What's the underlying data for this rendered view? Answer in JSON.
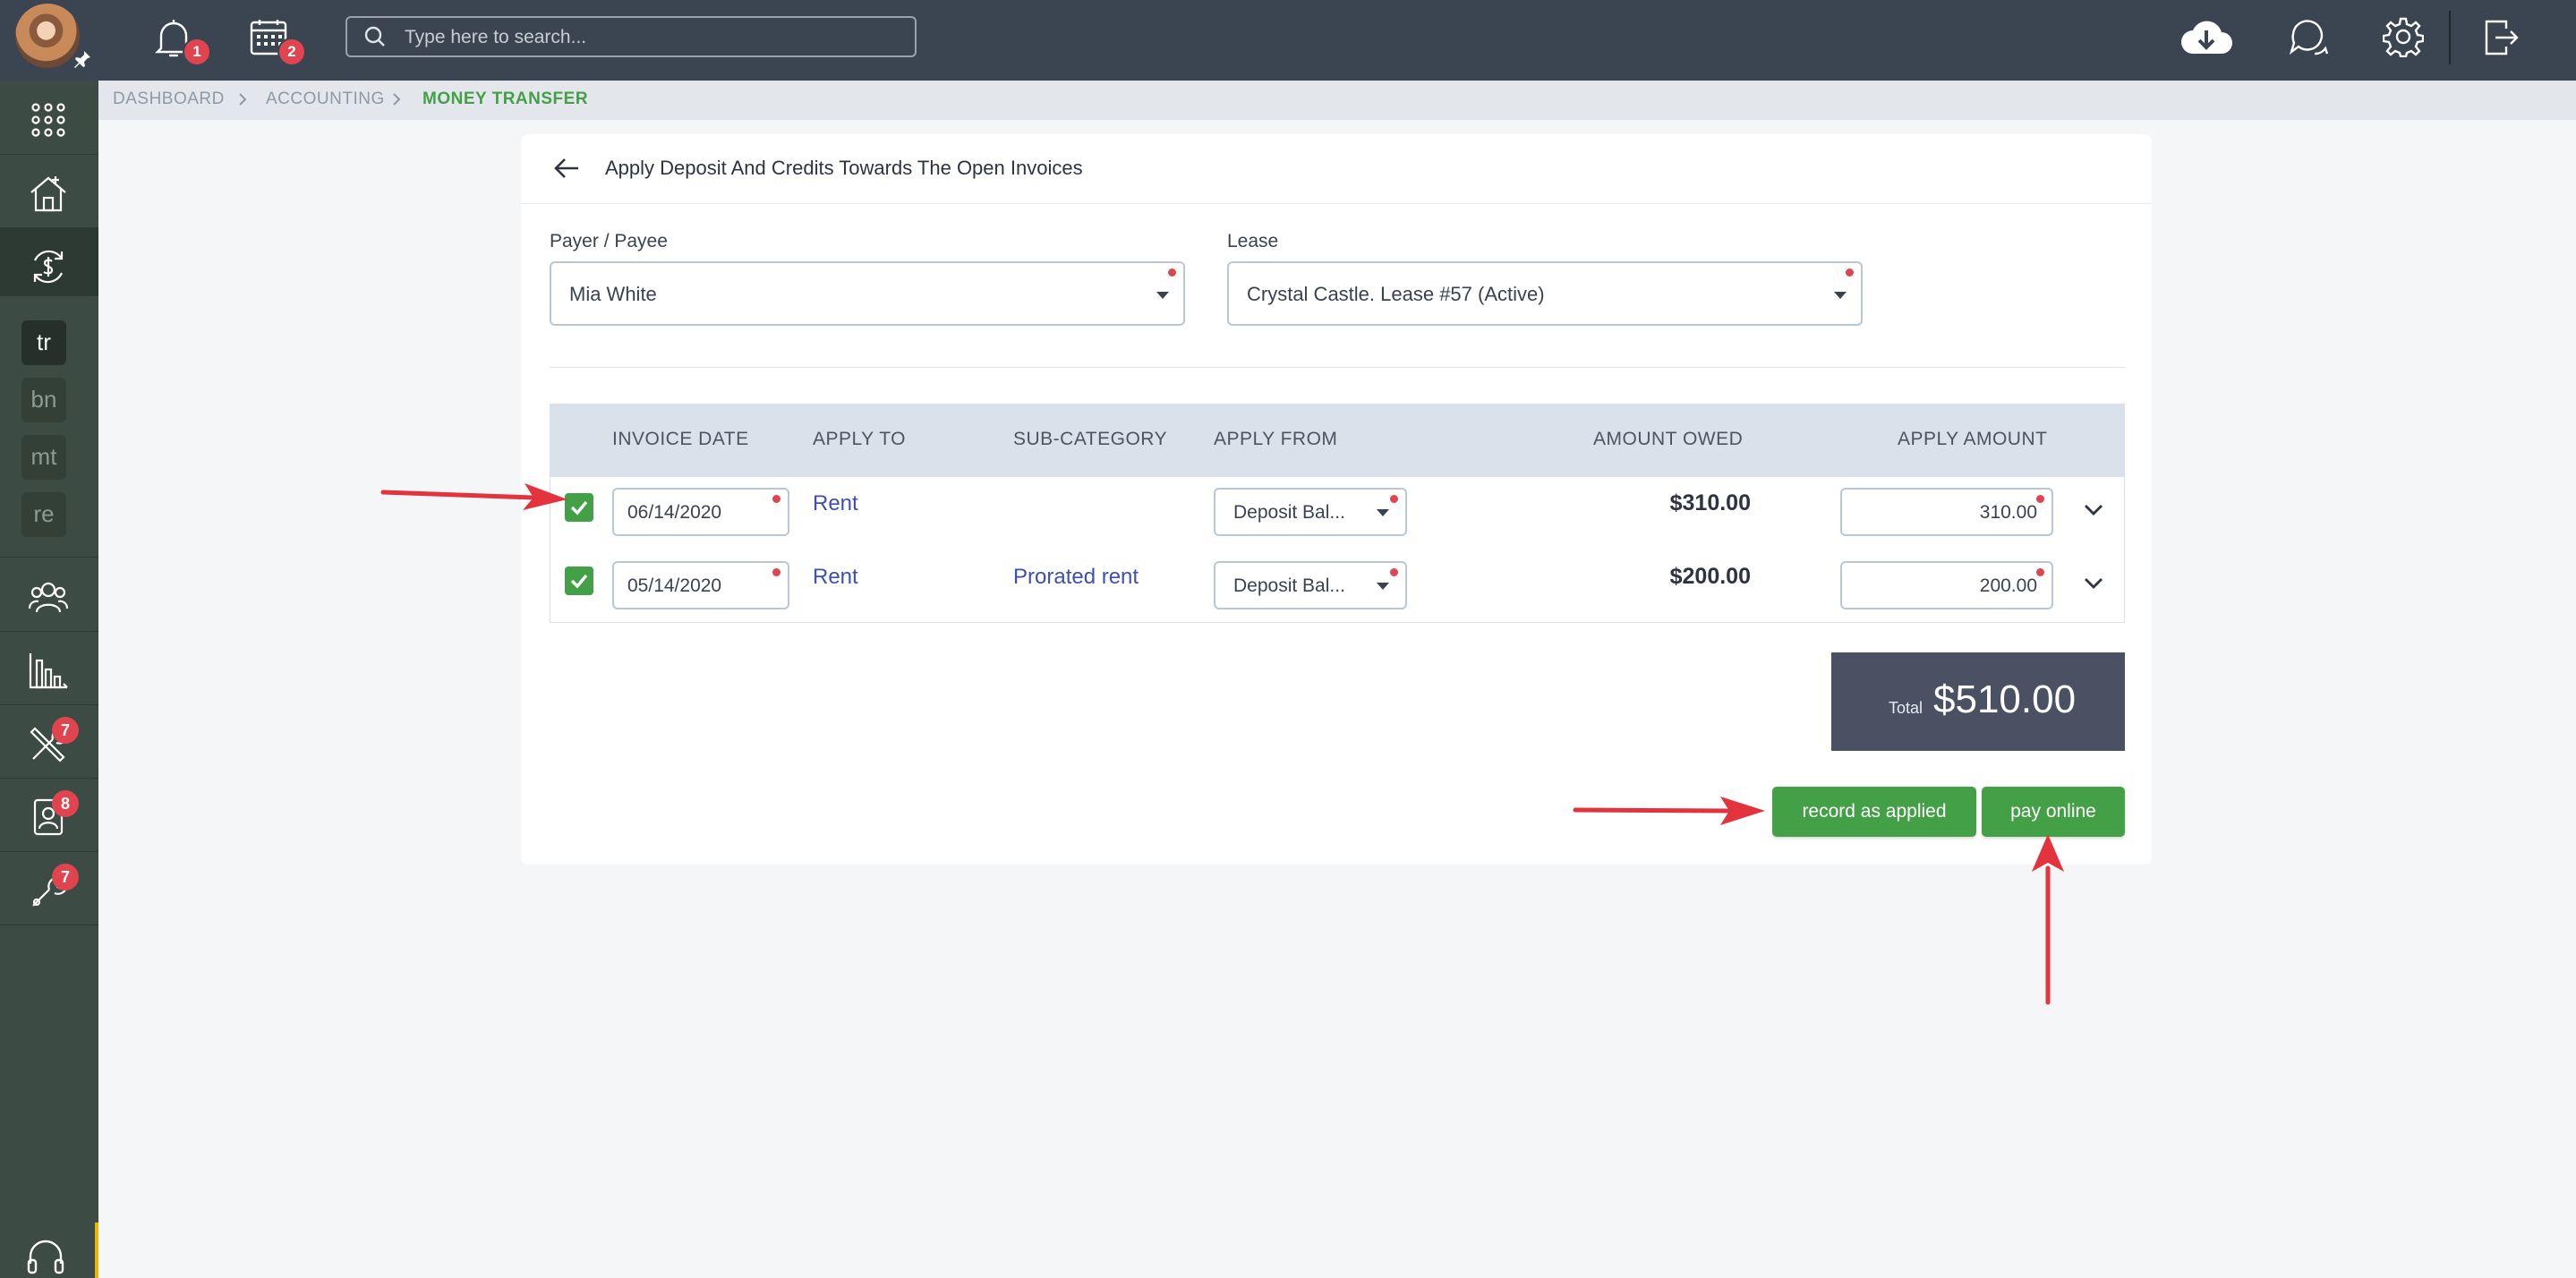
{
  "topbar": {
    "search_placeholder": "Type here to search...",
    "notifications_count": "1",
    "calendar_count": "2",
    "icons": [
      "bell-icon",
      "calendar-icon",
      "search-icon",
      "cloud-download-icon",
      "chat-icon",
      "gear-icon",
      "logout-icon"
    ]
  },
  "sidebar": {
    "items": [
      {
        "name": "apps",
        "icon": "grid-icon"
      },
      {
        "name": "properties",
        "icon": "house-icon"
      },
      {
        "name": "accounting",
        "icon": "money-transfer-icon"
      },
      {
        "name": "people",
        "icon": "people-icon"
      },
      {
        "name": "reports",
        "icon": "chart-icon"
      },
      {
        "name": "maintenance",
        "icon": "tools-icon",
        "badge": "7"
      },
      {
        "name": "applications",
        "icon": "contact-card-icon",
        "badge": "8"
      },
      {
        "name": "marketplace",
        "icon": "wrench-icon",
        "badge": "7"
      }
    ],
    "sub_items": [
      "tr",
      "bn",
      "mt",
      "re"
    ]
  },
  "breadcrumb": [
    "DASHBOARD",
    "ACCOUNTING",
    "MONEY TRANSFER"
  ],
  "card": {
    "title": "Apply Deposit And Credits Towards The Open Invoices",
    "payer_label": "Payer / Payee",
    "payer_value": "Mia White",
    "lease_label": "Lease",
    "lease_value": "Crystal Castle. Lease #57 (Active)"
  },
  "table": {
    "columns": [
      "INVOICE DATE",
      "APPLY TO",
      "SUB-CATEGORY",
      "APPLY FROM",
      "AMOUNT OWED",
      "APPLY AMOUNT"
    ],
    "rows": [
      {
        "checked": true,
        "date": "06/14/2020",
        "apply_to": "Rent",
        "sub_category": "",
        "apply_from": "Deposit Bal...",
        "owed": "$310.00",
        "apply_amount": "310.00"
      },
      {
        "checked": true,
        "date": "05/14/2020",
        "apply_to": "Rent",
        "sub_category": "Prorated rent",
        "apply_from": "Deposit Bal...",
        "owed": "$200.00",
        "apply_amount": "200.00"
      }
    ]
  },
  "total": {
    "label": "Total",
    "value": "$510.00"
  },
  "buttons": {
    "record": "record as applied",
    "pay": "pay online"
  },
  "colors": {
    "primary_green": "#43a047",
    "annotation_red": "#e3333c",
    "topbar": "#3b4451",
    "sidebar": "#3c4b43"
  }
}
